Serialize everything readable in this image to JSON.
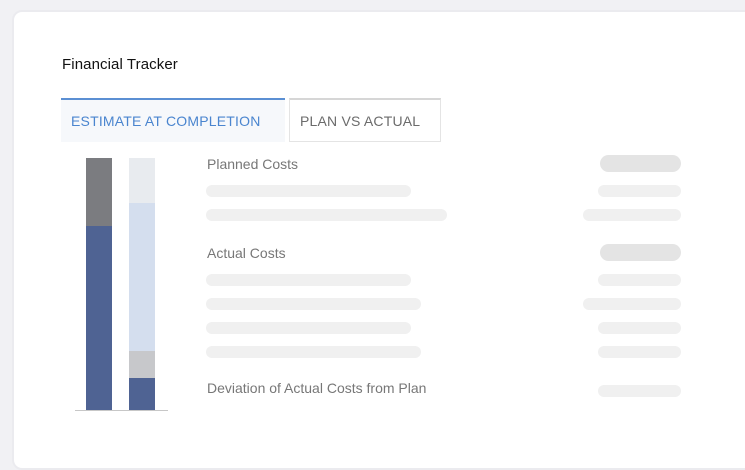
{
  "widget": {
    "title": "Financial Tracker",
    "tabs": [
      {
        "label": "ESTIMATE AT COMPLETION",
        "active": true
      },
      {
        "label": "PLAN VS ACTUAL",
        "active": false
      }
    ]
  },
  "sections": [
    {
      "label": "Planned Costs"
    },
    {
      "label": "Actual Costs"
    },
    {
      "label": "Deviation of Actual Costs from Plan"
    }
  ],
  "colors": {
    "accent": "#4a85cf",
    "planned_bar_top": "#7b7c80",
    "planned_bar_bottom": "#4f6393",
    "actual_bar_top": "#e8ebef",
    "actual_bar_mid": "#d4deee",
    "actual_bar_gray": "#c7c8cb",
    "actual_bar_bottom": "#4f6393",
    "skeleton": "#f0f0f0",
    "skeleton_dark": "#e4e4e4"
  },
  "icons": []
}
